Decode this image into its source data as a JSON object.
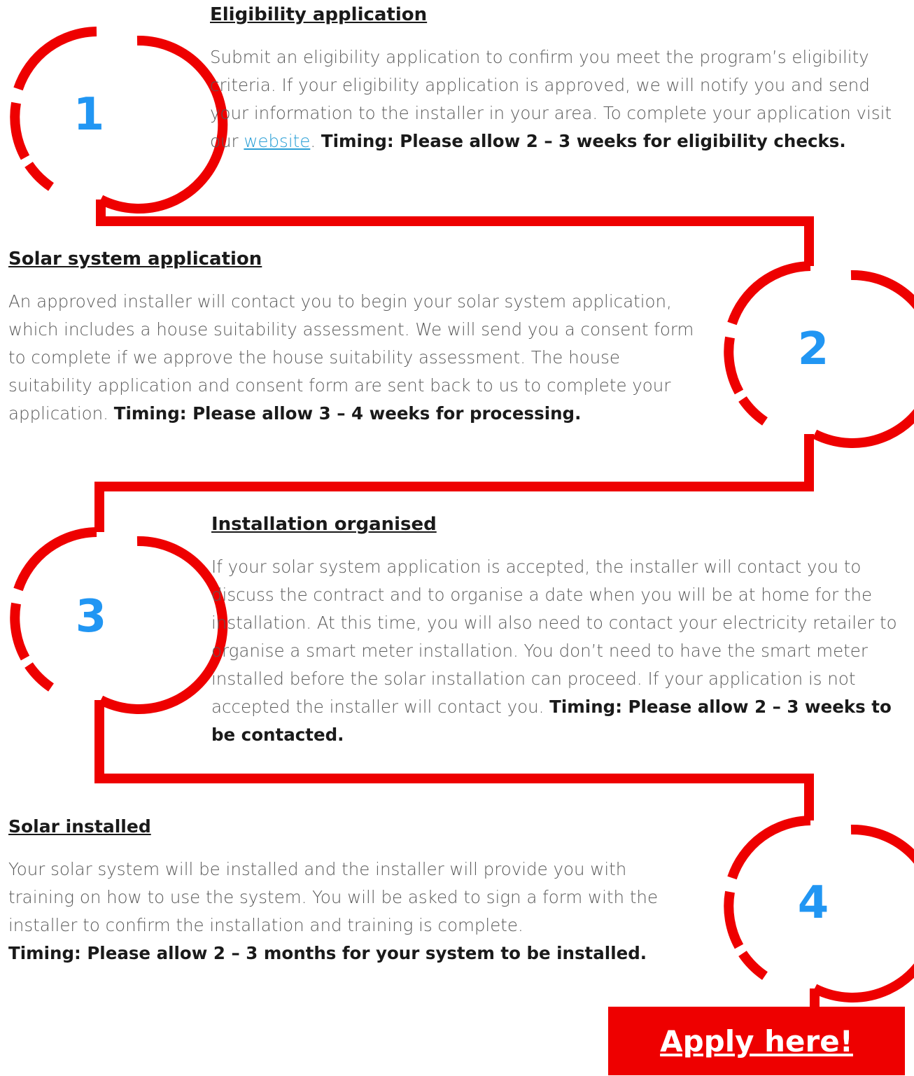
{
  "theme": {
    "accent_red": "#ee0000",
    "number_blue": "#2196f3",
    "link_blue": "#2a9fd6"
  },
  "steps": [
    {
      "number": "1",
      "title": "Eligibility application",
      "body_before_link": "Submit an eligibility application to confirm you meet the program’s eligibility criteria. If your eligibility application is approved, we will notify you and send your information to the installer in your area. To complete your application visit our ",
      "link_text": "website",
      "body_after_link": ". ",
      "timing": "Timing: Please allow 2 – 3 weeks for eligibility checks."
    },
    {
      "number": "2",
      "title": "Solar system application",
      "body": "An approved installer will contact you to begin your solar system application, which includes a house suitability assessment. We will send you a consent form to complete if we approve the house suitability assessment. The house suitability application and consent form are sent back to us to complete your application. ",
      "timing": "Timing: Please allow 3 – 4 weeks for processing."
    },
    {
      "number": "3",
      "title": "Installation organised",
      "body": "If your solar system application is accepted, the installer will contact you to discuss the contract and to organise a date when you will be at home for the installation. At this time, you will also need to contact your electricity retailer to organise a smart meter installation. You don’t need to have the smart meter installed before the solar installation can proceed. If your application is not accepted the installer will contact you. ",
      "timing": "Timing: Please allow 2 – 3 weeks to be contacted."
    },
    {
      "number": "4",
      "title": "Solar installed",
      "body": "Your solar system will be installed and the installer will provide you with training on how to use the system. You will be asked to sign a form with the installer to confirm the installation and training is complete.",
      "timing": "Timing: Please allow 2 – 3 months for your system to be installed."
    }
  ],
  "cta": {
    "label": "Apply here!"
  }
}
